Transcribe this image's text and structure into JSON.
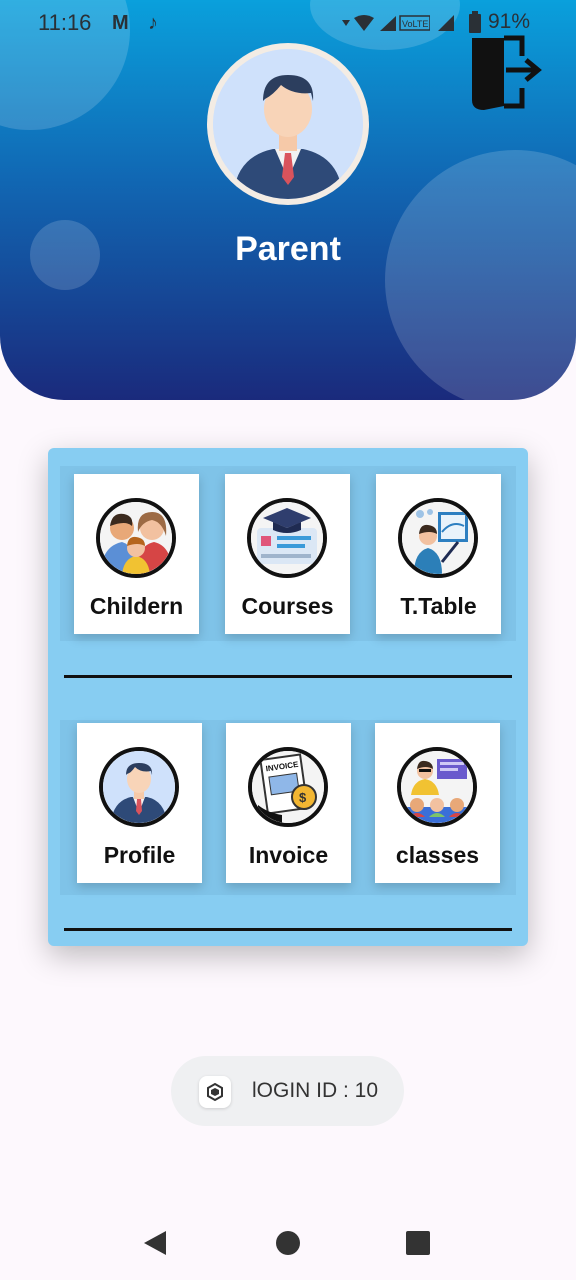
{
  "status_bar": {
    "time": "11:16",
    "battery": "91%",
    "icons": [
      "gmail-icon",
      "tiktok-icon",
      "wifi-icon",
      "signal-icon",
      "volte-icon",
      "signal-icon",
      "battery-icon"
    ]
  },
  "header": {
    "title": "Parent",
    "colors": {
      "top": "#0aa0dc",
      "bottom": "#1a2a7c"
    }
  },
  "menu": {
    "items": [
      {
        "label": "Childern",
        "icon": "family-icon"
      },
      {
        "label": "Courses",
        "icon": "courses-icon"
      },
      {
        "label": "T.Table",
        "icon": "timetable-icon"
      },
      {
        "label": "Profile",
        "icon": "profile-icon"
      },
      {
        "label": "Invoice",
        "icon": "invoice-icon"
      },
      {
        "label": "classes",
        "icon": "classes-icon"
      }
    ]
  },
  "toast": {
    "text": "lOGIN ID : 10"
  },
  "colors": {
    "panel": "#87cdf2",
    "background": "#fdf8fd"
  }
}
